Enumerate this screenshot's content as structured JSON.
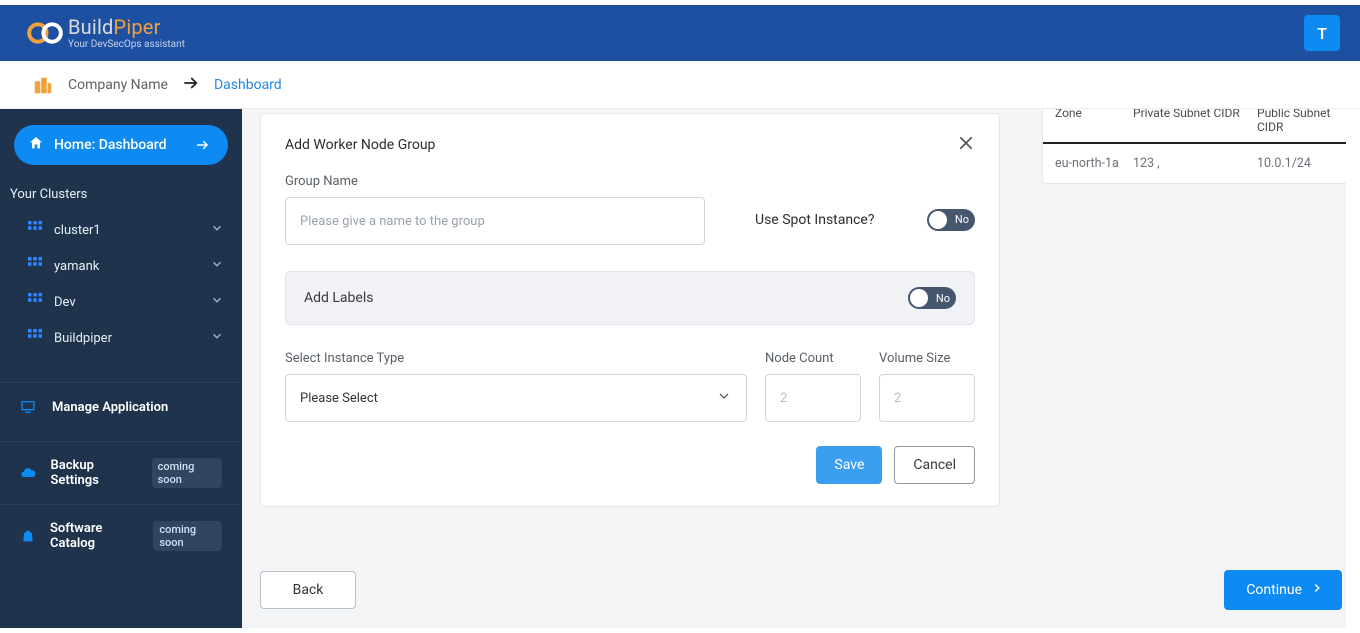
{
  "brand": {
    "name_build": "Build",
    "name_piper": "Piper",
    "sub": "Your DevSecOps assistant"
  },
  "user": {
    "initial": "T"
  },
  "crumb": {
    "company": "Company Name",
    "dashboard": "Dashboard"
  },
  "sidebar": {
    "home": "Home: Dashboard",
    "section": "Your Clusters",
    "clusters": [
      {
        "label": "cluster1"
      },
      {
        "label": "yamank"
      },
      {
        "label": "Dev"
      },
      {
        "label": "Buildpiper"
      }
    ],
    "manage_app": "Manage Application",
    "backup": "Backup Settings",
    "catalog": "Software Catalog",
    "soon": "coming soon"
  },
  "form": {
    "title": "Add Worker Node Group",
    "group_name_label": "Group Name",
    "group_name_placeholder": "Please give a name to the group",
    "spot_question": "Use Spot Instance?",
    "switch_no": "No",
    "add_labels": "Add Labels",
    "instance_type_label": "Select Instance Type",
    "instance_type_placeholder": "Please Select",
    "node_count_label": "Node Count",
    "node_count_placeholder": "2",
    "volume_size_label": "Volume Size",
    "volume_size_placeholder": "2",
    "save": "Save",
    "cancel": "Cancel"
  },
  "right_table": {
    "col1": "Zone",
    "col2": "Private Subnet CIDR",
    "col3": "Public Subnet CIDR",
    "row": {
      "zone": "eu-north-1a",
      "priv": "123 ,",
      "pub": "10.0.1/24"
    }
  },
  "bottom": {
    "back": "Back",
    "continue": "Continue"
  }
}
